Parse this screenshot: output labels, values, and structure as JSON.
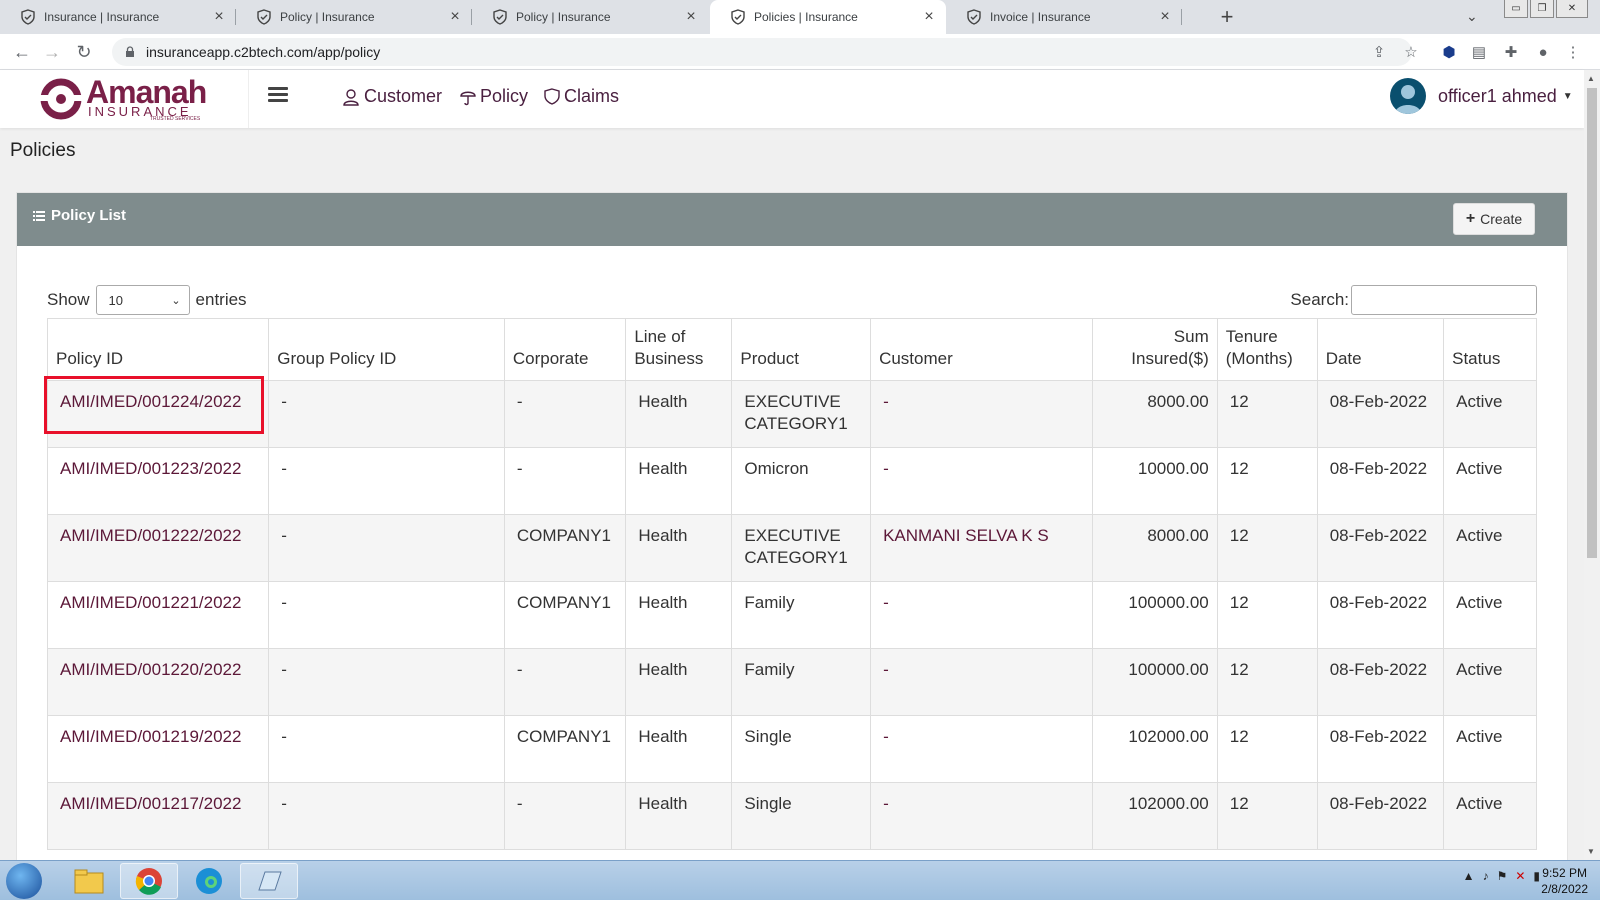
{
  "browser": {
    "tabs": [
      {
        "title": "Insurance | Insurance",
        "active": false
      },
      {
        "title": "Policy | Insurance",
        "active": false
      },
      {
        "title": "Policy | Insurance",
        "active": false
      },
      {
        "title": "Policies | Insurance",
        "active": true
      },
      {
        "title": "Invoice | Insurance",
        "active": false
      }
    ],
    "url": "insuranceapp.c2btech.com/app/policy"
  },
  "header": {
    "logo_word": "Amanah",
    "logo_sub": "INSURANCE",
    "logo_tag": "TRUSTED SERVICES",
    "nav": [
      {
        "label": "Customer",
        "icon": "user-icon"
      },
      {
        "label": "Policy",
        "icon": "umbrella-icon"
      },
      {
        "label": "Claims",
        "icon": "shield-icon"
      }
    ],
    "user_name": "officer1 ahmed"
  },
  "page": {
    "title": "Policies",
    "card_title": "Policy List",
    "create_label": "Create",
    "show_label": "Show",
    "entries_value": "10",
    "entries_label": "entries",
    "search_label": "Search:"
  },
  "table": {
    "columns": [
      "Policy ID",
      "Group Policy ID",
      "Corporate",
      "Line of Business",
      "Product",
      "Customer",
      "Sum Insured($)",
      "Tenure (Months)",
      "Date",
      "Status"
    ],
    "rows": [
      [
        "AMI/IMED/001224/2022",
        "-",
        "-",
        "Health",
        "EXECUTIVE CATEGORY1",
        "-",
        "8000.00",
        "12",
        "08-Feb-2022",
        "Active"
      ],
      [
        "AMI/IMED/001223/2022",
        "-",
        "-",
        "Health",
        "Omicron",
        "-",
        "10000.00",
        "12",
        "08-Feb-2022",
        "Active"
      ],
      [
        "AMI/IMED/001222/2022",
        "-",
        "COMPANY1",
        "Health",
        "EXECUTIVE CATEGORY1",
        "KANMANI SELVA K S",
        "8000.00",
        "12",
        "08-Feb-2022",
        "Active"
      ],
      [
        "AMI/IMED/001221/2022",
        "-",
        "COMPANY1",
        "Health",
        "Family",
        "-",
        "100000.00",
        "12",
        "08-Feb-2022",
        "Active"
      ],
      [
        "AMI/IMED/001220/2022",
        "-",
        "-",
        "Health",
        "Family",
        "-",
        "100000.00",
        "12",
        "08-Feb-2022",
        "Active"
      ],
      [
        "AMI/IMED/001219/2022",
        "-",
        "COMPANY1",
        "Health",
        "Single",
        "-",
        "102000.00",
        "12",
        "08-Feb-2022",
        "Active"
      ],
      [
        "AMI/IMED/001217/2022",
        "-",
        "-",
        "Health",
        "Single",
        "-",
        "102000.00",
        "12",
        "08-Feb-2022",
        "Active"
      ]
    ]
  },
  "taskbar": {
    "time": "9:52 PM",
    "date": "2/8/2022"
  },
  "colors": {
    "brand": "#7a2048",
    "card_header": "#7f8c8d",
    "highlight": "#e8102a"
  }
}
